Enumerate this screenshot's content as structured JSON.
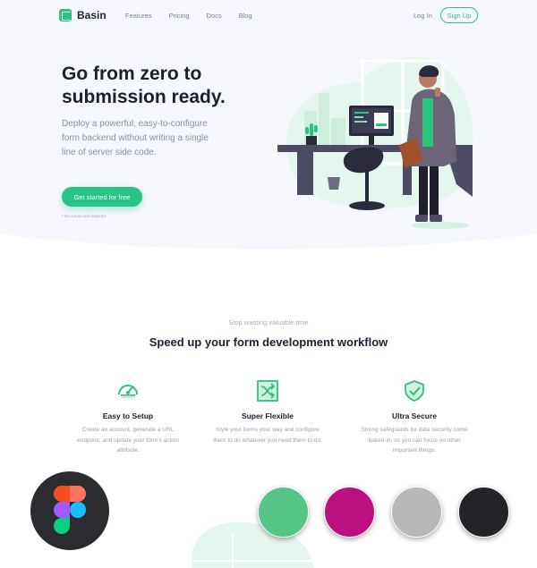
{
  "nav": {
    "brand": "Basin",
    "links": [
      "Features",
      "Pricing",
      "Docs",
      "Blog"
    ],
    "login": "Log In",
    "signup": "Sign Up"
  },
  "hero": {
    "title": "Go from zero to submission ready.",
    "subtitle": "Deploy a powerful, easy-to-configure form backend without writing a single line of server side code.",
    "cta": "Get started for free",
    "note": "* No credit card required"
  },
  "section": {
    "eyebrow": "Stop wasting valuable time",
    "title": "Speed up your form development workflow"
  },
  "features": [
    {
      "icon": "speedometer-icon",
      "title": "Easy to Setup",
      "description": "Create an account, generate a URL endpoint, and update your form's action attribute."
    },
    {
      "icon": "shuffle-icon",
      "title": "Super Flexible",
      "description": "Style your forms your way and configure them to do whatever you need them to do."
    },
    {
      "icon": "shield-check-icon",
      "title": "Ultra Secure",
      "description": "Strong safeguards for data security come baked-in, so you can focus on other important things."
    }
  ],
  "palette": {
    "brand_green": "#2ec27e",
    "swatches": [
      "#55c585",
      "#bb1080",
      "#b8b8b8",
      "#232428"
    ]
  },
  "overlay": {
    "icon": "figma-icon"
  }
}
